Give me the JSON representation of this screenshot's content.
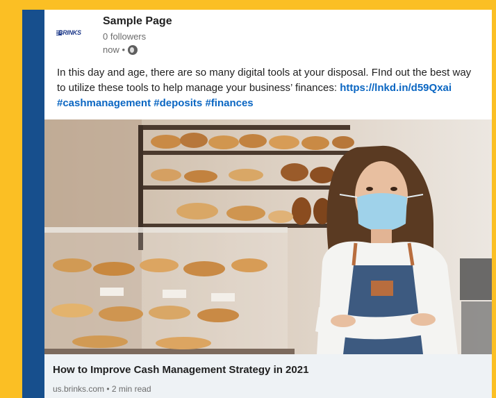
{
  "page": {
    "name": "Sample Page",
    "followers": "0 followers",
    "time": "now •"
  },
  "logo": {
    "text": "BRINKS"
  },
  "post": {
    "text": "In this day and age, there are so many digital tools at your disposal. FInd out the best way to utilize these tools to help manage your business’ finances:",
    "link": "https://lnkd.in/d59Qxai",
    "hashtags": [
      "#cashmanagement",
      "#deposits",
      "#finances"
    ]
  },
  "article": {
    "title": "How to Improve Cash Management Strategy in 2021",
    "meta": "us.brinks.com • 2 min read"
  },
  "colors": {
    "frame": "#fbbf24",
    "sidebar": "#174f8d",
    "link": "#0a66c2"
  }
}
